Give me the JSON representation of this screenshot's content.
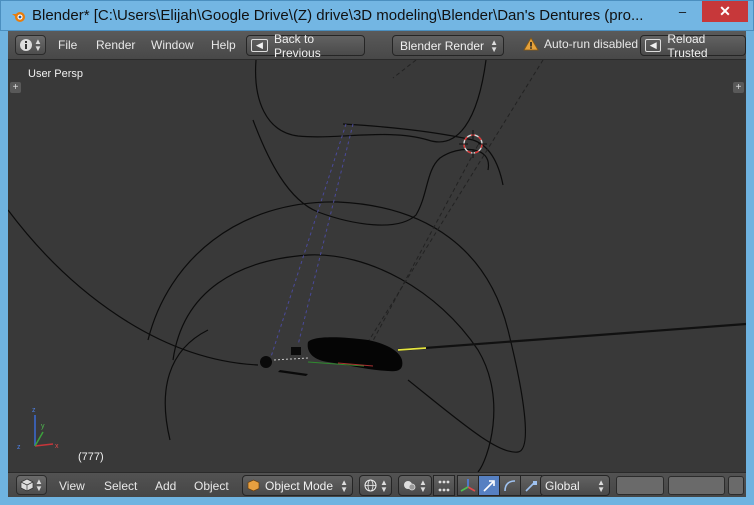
{
  "window": {
    "title": "Blender* [C:\\Users\\Elijah\\Google Drive\\(Z) drive\\3D modeling\\Blender\\Dan's Dentures (pro...",
    "minimize": "–",
    "maximize": "□",
    "close": "✕"
  },
  "topbar": {
    "menus": [
      "File",
      "Render",
      "Window",
      "Help"
    ],
    "back_label": "Back to Previous",
    "render_engine": "Blender Render",
    "warning": "Auto-run disabled",
    "reload_label": "Reload Trusted"
  },
  "viewport": {
    "view_name": "User Persp",
    "frame": "(777)",
    "plus": "+"
  },
  "bottombar": {
    "menus": [
      "View",
      "Select",
      "Add",
      "Object"
    ],
    "mode": "Object Mode",
    "orientation": "Global"
  },
  "colors": {
    "accent_selected": "#5680c2",
    "warning": "#e6a23c",
    "close_red": "#c7383a"
  }
}
